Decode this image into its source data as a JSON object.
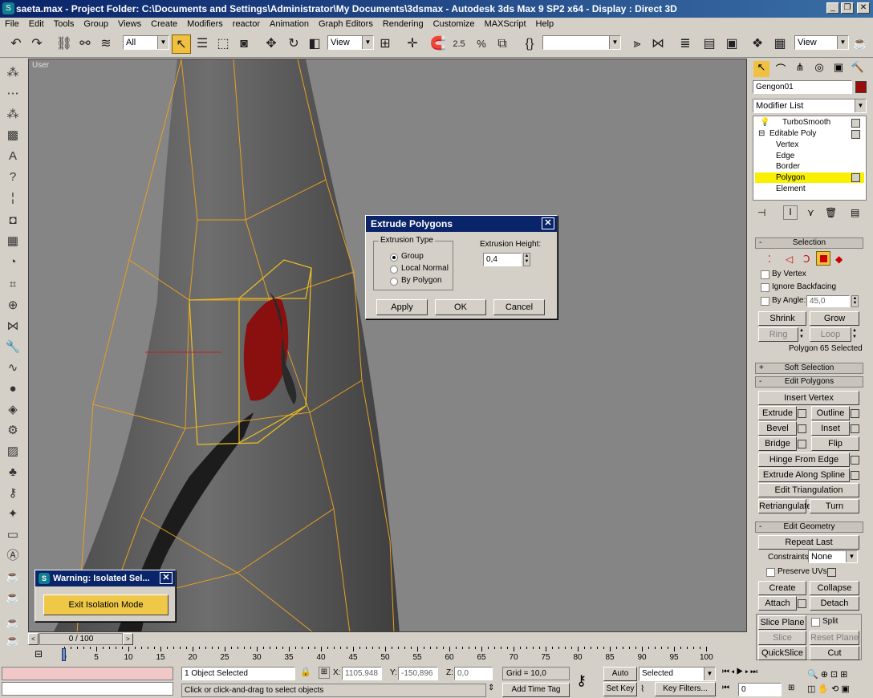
{
  "window": {
    "title": "saeta.max    - Project Folder: C:\\Documents and Settings\\Administrator\\My Documents\\3dsmax    - Autodesk 3ds Max 9 SP2 x64    - Display : Direct 3D"
  },
  "menu": [
    "File",
    "Edit",
    "Tools",
    "Group",
    "Views",
    "Create",
    "Modifiers",
    "reactor",
    "Animation",
    "Graph Editors",
    "Rendering",
    "Customize",
    "MAXScript",
    "Help"
  ],
  "toolbar": {
    "selection_filter": "All",
    "ref_coord": "View",
    "named_selection": "",
    "render_view": "View",
    "spinner_snap_label": "2.5",
    "percent_snap_label": "%"
  },
  "viewport": {
    "label": "User"
  },
  "extrude_dialog": {
    "title": "Extrude Polygons",
    "group_label": "Extrusion Type",
    "options": [
      "Group",
      "Local Normal",
      "By Polygon"
    ],
    "selected_option": "Group",
    "height_label": "Extrusion Height:",
    "height_value": "0,4",
    "apply": "Apply",
    "ok": "OK",
    "cancel": "Cancel"
  },
  "isolation_dialog": {
    "title": "Warning: Isolated Sel...",
    "button": "Exit Isolation Mode"
  },
  "command_panel": {
    "object_name": "Gengon01",
    "object_color": "#9a0c0c",
    "modifier_list": "Modifier List",
    "stack": [
      {
        "label": "TurboSmooth",
        "level": 0
      },
      {
        "label": "Editable Poly",
        "level": 0
      },
      {
        "label": "Vertex",
        "level": 1
      },
      {
        "label": "Edge",
        "level": 1
      },
      {
        "label": "Border",
        "level": 1
      },
      {
        "label": "Polygon",
        "level": 1,
        "selected": true
      },
      {
        "label": "Element",
        "level": 1
      }
    ],
    "selection": {
      "header": "Selection",
      "by_vertex": "By Vertex",
      "ignore_backfacing": "Ignore Backfacing",
      "by_angle": "By Angle:",
      "angle_value": "45,0",
      "shrink": "Shrink",
      "grow": "Grow",
      "ring": "Ring",
      "loop": "Loop",
      "status": "Polygon 65 Selected"
    },
    "soft_selection": "Soft Selection",
    "edit_polygons": {
      "header": "Edit Polygons",
      "insert_vertex": "Insert Vertex",
      "extrude": "Extrude",
      "outline": "Outline",
      "bevel": "Bevel",
      "inset": "Inset",
      "bridge": "Bridge",
      "flip": "Flip",
      "hinge": "Hinge From Edge",
      "extrude_spline": "Extrude Along Spline",
      "edit_tri": "Edit Triangulation",
      "retri": "Retriangulate",
      "turn": "Turn"
    },
    "edit_geometry": {
      "header": "Edit Geometry",
      "repeat_last": "Repeat Last",
      "constraints_label": "Constraints:",
      "constraints_value": "None",
      "preserve_uvs": "Preserve UVs",
      "create": "Create",
      "collapse": "Collapse",
      "attach": "Attach",
      "detach": "Detach",
      "slice_plane": "Slice Plane",
      "split": "Split",
      "slice": "Slice",
      "reset_plane": "Reset Plane",
      "quickslice": "QuickSlice",
      "cut": "Cut"
    }
  },
  "timeline": {
    "frame_label": "0 / 100",
    "ticks": [
      "0",
      "5",
      "10",
      "15",
      "20",
      "25",
      "30",
      "35",
      "40",
      "45",
      "50",
      "55",
      "60",
      "65",
      "70",
      "75",
      "80",
      "85",
      "90",
      "95",
      "100"
    ]
  },
  "status": {
    "selected": "1 Object Selected",
    "prompt": "Click or click-and-drag to select objects",
    "x_label": "X:",
    "x": "1105,948",
    "y_label": "Y:",
    "y": "-150,896",
    "z_label": "Z:",
    "z": "0,0",
    "grid": "Grid = 10,0",
    "add_time_tag": "Add Time Tag",
    "auto_key": "Auto Key",
    "set_key": "Set Key",
    "selected_set": "Selected",
    "key_filters": "Key Filters...",
    "frame": "0"
  }
}
